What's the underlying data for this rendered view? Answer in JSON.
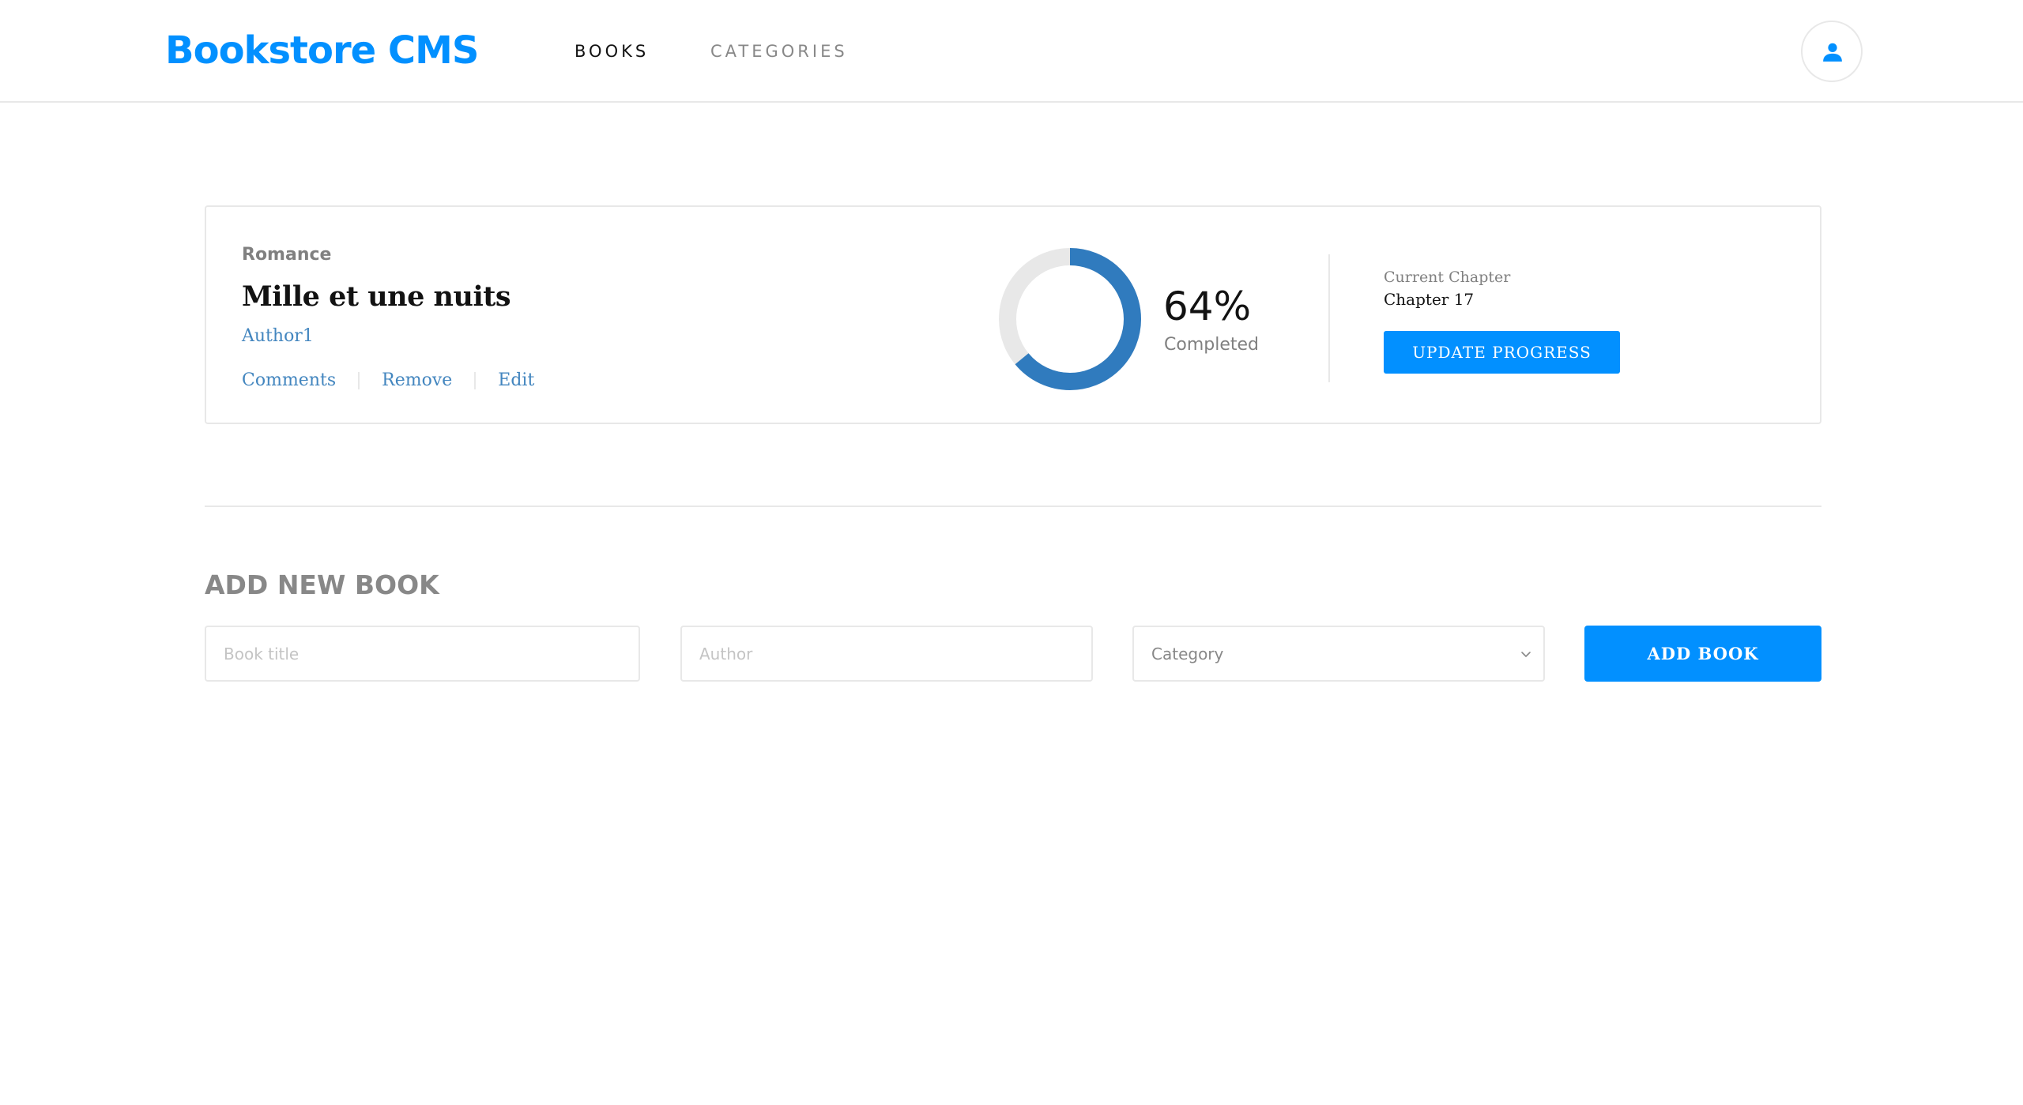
{
  "header": {
    "logo": "Bookstore CMS",
    "nav": [
      {
        "label": "BOOKS",
        "active": true
      },
      {
        "label": "CATEGORIES",
        "active": false
      }
    ],
    "user_icon": "user-icon"
  },
  "book": {
    "category": "Romance",
    "title": "Mille et une nuits",
    "author": "Author1",
    "actions": [
      "Comments",
      "Remove",
      "Edit"
    ],
    "progress": {
      "percent": 64,
      "percent_label": "64%",
      "label": "Completed"
    },
    "chapter_label": "Current Chapter",
    "chapter_value": "Chapter 17",
    "update_button": "UPDATE PROGRESS"
  },
  "form": {
    "title": "ADD NEW BOOK",
    "title_placeholder": "Book title",
    "author_placeholder": "Author",
    "category_selected": "Category",
    "submit_label": "ADD BOOK"
  },
  "colors": {
    "accent": "#0290ff",
    "ring": "#307bbe",
    "ring_track": "#e8e8e8",
    "link": "#4386bf"
  }
}
